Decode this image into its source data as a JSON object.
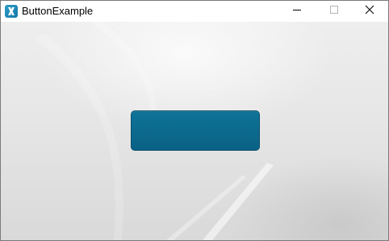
{
  "window": {
    "title": "ButtonExample",
    "icon": "xamarin-x-icon",
    "controls": {
      "minimize_icon": "minimize-icon",
      "maximize_icon": "maximize-icon",
      "close_icon": "close-icon"
    }
  },
  "main": {
    "button_label": ""
  },
  "colors": {
    "titlebar": "#ffffff",
    "background_top": "#eeeeee",
    "background_bottom": "#d9d9d9",
    "button_fill": "#0c6a8e",
    "button_border": "#0a4f6a",
    "app_icon": "#1678a8"
  }
}
